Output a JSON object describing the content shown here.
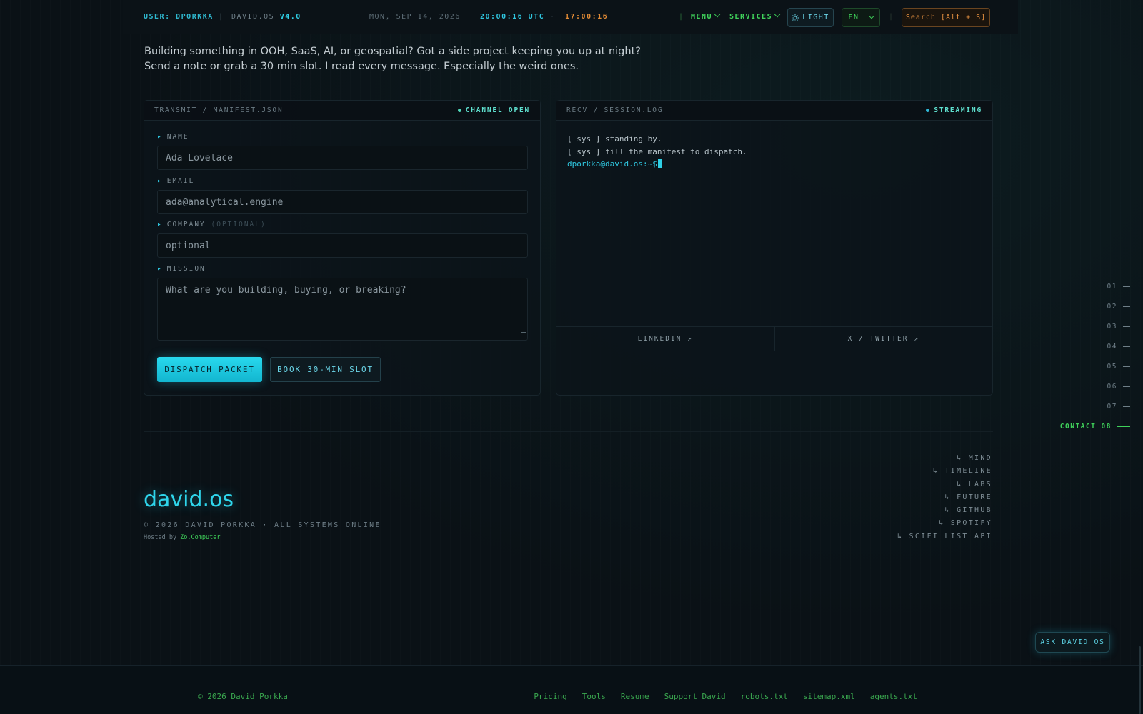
{
  "topbar": {
    "user_prefix": "USER:",
    "user_name": "DPORKKA",
    "separator": "|",
    "os_name": "DAVID.OS",
    "os_version": "V4.0",
    "date": "MON, SEP 14, 2026",
    "utc_time": "20:00:16 UTC",
    "dot": "·",
    "local_time": "17:00:16",
    "bar": "|",
    "menu_label": "MENU",
    "services_label": "SERVICES",
    "light_label": "LIGHT",
    "lang_label": "EN",
    "search_label": "Search [Alt + S]"
  },
  "intro": {
    "line1": "Building something in OOH, SaaS, AI, or geospatial? Got a side project keeping you up at night?",
    "line2": "Send a note or grab a 30 min slot. I read every message. Especially the weird ones."
  },
  "form": {
    "title": "TRANSMIT / MANIFEST.JSON",
    "status": "CHANNEL OPEN",
    "name_label": "NAME",
    "name_placeholder": "Ada Lovelace",
    "email_label": "EMAIL",
    "email_placeholder": "ada@analytical.engine",
    "company_label": "COMPANY",
    "company_optional": "(OPTIONAL)",
    "company_placeholder": "optional",
    "mission_label": "MISSION",
    "mission_placeholder": "What are you building, buying, or breaking?",
    "dispatch_label": "DISPATCH PACKET",
    "book_label": "BOOK 30-MIN SLOT"
  },
  "log": {
    "title": "RECV / SESSION.LOG",
    "status": "STREAMING",
    "line1": "[ sys ] standing by.",
    "line2": "[ sys ] fill the manifest to dispatch.",
    "prompt": "dporkka@david.os:~$",
    "linkedin": "LINKEDIN ↗",
    "twitter": "X / TWITTER ↗"
  },
  "rail": [
    "01",
    "02",
    "03",
    "04",
    "05",
    "06",
    "07",
    "CONTACT 08"
  ],
  "footer": {
    "brand": "david.os",
    "copyright": "© 2026 DAVID PORKKA · ALL SYSTEMS ONLINE",
    "hosted_prefix": "Hosted by",
    "hosted_link": "Zo.Computer",
    "nav": [
      "↳ MIND",
      "↳ TIMELINE",
      "↳ LABS",
      "↳ FUTURE",
      "↳ GITHUB",
      "↳ SPOTIFY",
      "↳ SCIFI LIST API"
    ]
  },
  "ask_label": "ASK DAVID OS",
  "bottombar": {
    "copyright": "© 2026 David Porkka",
    "links": [
      "Pricing",
      "Tools",
      "Resume",
      "Support David",
      "robots.txt",
      "sitemap.xml",
      "agents.txt"
    ]
  },
  "colors": {
    "accent_cyan": "#2fd0e6",
    "accent_green": "#3fd15a",
    "accent_orange": "#e08a35",
    "background": "#0a1116"
  },
  "icons": {
    "light": "sun-icon",
    "chevron": "chevron-down-icon",
    "status_led": "status-dot-icon"
  }
}
